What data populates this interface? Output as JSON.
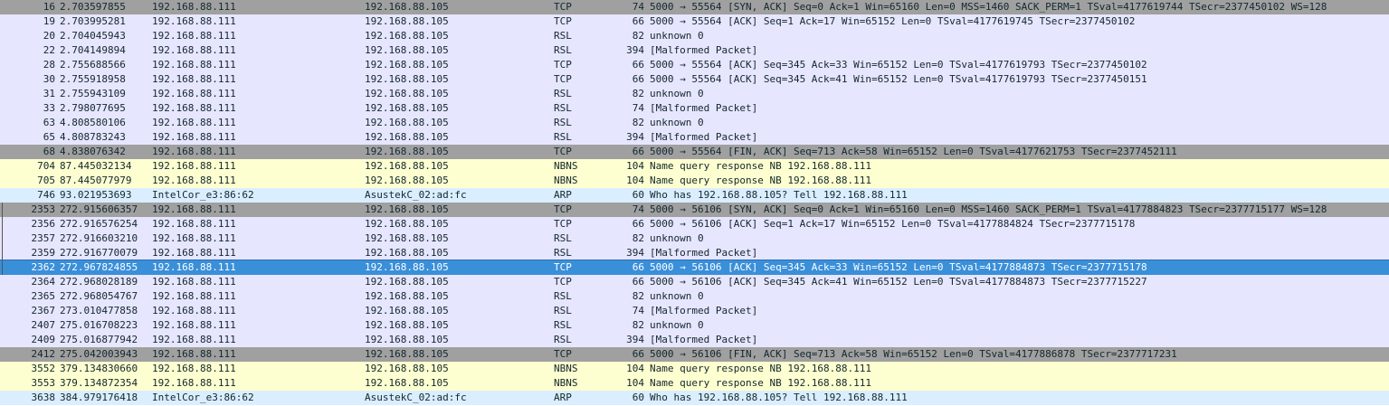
{
  "packets": [
    {
      "no": "16",
      "time": "2.703597855",
      "src": "192.168.88.111",
      "dst": "192.168.88.105",
      "proto": "TCP",
      "len": "74",
      "info": "5000 → 55564 [SYN, ACK] Seq=0 Ack=1 Win=65160 Len=0 MSS=1460 SACK_PERM=1 TSval=4177619744 TSecr=2377450102 WS=128",
      "style": "tcp-flag"
    },
    {
      "no": "19",
      "time": "2.703995281",
      "src": "192.168.88.111",
      "dst": "192.168.88.105",
      "proto": "TCP",
      "len": "66",
      "info": "5000 → 55564 [ACK] Seq=1 Ack=17 Win=65152 Len=0 TSval=4177619745 TSecr=2377450102",
      "style": "tcp"
    },
    {
      "no": "20",
      "time": "2.704045943",
      "src": "192.168.88.111",
      "dst": "192.168.88.105",
      "proto": "RSL",
      "len": "82",
      "info": "unknown 0",
      "style": "rsl"
    },
    {
      "no": "22",
      "time": "2.704149894",
      "src": "192.168.88.111",
      "dst": "192.168.88.105",
      "proto": "RSL",
      "len": "394",
      "info": "[Malformed Packet]",
      "style": "rsl"
    },
    {
      "no": "28",
      "time": "2.755688566",
      "src": "192.168.88.111",
      "dst": "192.168.88.105",
      "proto": "TCP",
      "len": "66",
      "info": "5000 → 55564 [ACK] Seq=345 Ack=33 Win=65152 Len=0 TSval=4177619793 TSecr=2377450102",
      "style": "tcp"
    },
    {
      "no": "30",
      "time": "2.755918958",
      "src": "192.168.88.111",
      "dst": "192.168.88.105",
      "proto": "TCP",
      "len": "66",
      "info": "5000 → 55564 [ACK] Seq=345 Ack=41 Win=65152 Len=0 TSval=4177619793 TSecr=2377450151",
      "style": "tcp"
    },
    {
      "no": "31",
      "time": "2.755943109",
      "src": "192.168.88.111",
      "dst": "192.168.88.105",
      "proto": "RSL",
      "len": "82",
      "info": "unknown 0",
      "style": "rsl"
    },
    {
      "no": "33",
      "time": "2.798077695",
      "src": "192.168.88.111",
      "dst": "192.168.88.105",
      "proto": "RSL",
      "len": "74",
      "info": "[Malformed Packet]",
      "style": "rsl"
    },
    {
      "no": "63",
      "time": "4.808580106",
      "src": "192.168.88.111",
      "dst": "192.168.88.105",
      "proto": "RSL",
      "len": "82",
      "info": "unknown 0",
      "style": "rsl"
    },
    {
      "no": "65",
      "time": "4.808783243",
      "src": "192.168.88.111",
      "dst": "192.168.88.105",
      "proto": "RSL",
      "len": "394",
      "info": "[Malformed Packet]",
      "style": "rsl"
    },
    {
      "no": "68",
      "time": "4.838076342",
      "src": "192.168.88.111",
      "dst": "192.168.88.105",
      "proto": "TCP",
      "len": "66",
      "info": "5000 → 55564 [FIN, ACK] Seq=713 Ack=58 Win=65152 Len=0 TSval=4177621753 TSecr=2377452111",
      "style": "tcp-flag"
    },
    {
      "no": "704",
      "time": "87.445032134",
      "src": "192.168.88.111",
      "dst": "192.168.88.105",
      "proto": "NBNS",
      "len": "104",
      "info": "Name query response NB 192.168.88.111",
      "style": "nbns"
    },
    {
      "no": "705",
      "time": "87.445077979",
      "src": "192.168.88.111",
      "dst": "192.168.88.105",
      "proto": "NBNS",
      "len": "104",
      "info": "Name query response NB 192.168.88.111",
      "style": "nbns"
    },
    {
      "no": "746",
      "time": "93.021953693",
      "src": "IntelCor_e3:86:62",
      "dst": "AsustekC_02:ad:fc",
      "proto": "ARP",
      "len": "60",
      "info": "Who has 192.168.88.105? Tell 192.168.88.111",
      "style": "arp"
    },
    {
      "no": "2353",
      "time": "272.915606357",
      "src": "192.168.88.111",
      "dst": "192.168.88.105",
      "proto": "TCP",
      "len": "74",
      "info": "5000 → 56106 [SYN, ACK] Seq=0 Ack=1 Win=65160 Len=0 MSS=1460 SACK_PERM=1 TSval=4177884823 TSecr=2377715177 WS=128",
      "style": "tcp-flag"
    },
    {
      "no": "2356",
      "time": "272.916576254",
      "src": "192.168.88.111",
      "dst": "192.168.88.105",
      "proto": "TCP",
      "len": "66",
      "info": "5000 → 56106 [ACK] Seq=1 Ack=17 Win=65152 Len=0 TSval=4177884824 TSecr=2377715178",
      "style": "tcp"
    },
    {
      "no": "2357",
      "time": "272.916603210",
      "src": "192.168.88.111",
      "dst": "192.168.88.105",
      "proto": "RSL",
      "len": "82",
      "info": "unknown 0",
      "style": "rsl"
    },
    {
      "no": "2359",
      "time": "272.916770079",
      "src": "192.168.88.111",
      "dst": "192.168.88.105",
      "proto": "RSL",
      "len": "394",
      "info": "[Malformed Packet]",
      "style": "rsl"
    },
    {
      "no": "2362",
      "time": "272.967824855",
      "src": "192.168.88.111",
      "dst": "192.168.88.105",
      "proto": "TCP",
      "len": "66",
      "info": "5000 → 56106 [ACK] Seq=345 Ack=33 Win=65152 Len=0 TSval=4177884873 TSecr=2377715178",
      "style": "selected"
    },
    {
      "no": "2364",
      "time": "272.968028189",
      "src": "192.168.88.111",
      "dst": "192.168.88.105",
      "proto": "TCP",
      "len": "66",
      "info": "5000 → 56106 [ACK] Seq=345 Ack=41 Win=65152 Len=0 TSval=4177884873 TSecr=2377715227",
      "style": "tcp"
    },
    {
      "no": "2365",
      "time": "272.968054767",
      "src": "192.168.88.111",
      "dst": "192.168.88.105",
      "proto": "RSL",
      "len": "82",
      "info": "unknown 0",
      "style": "rsl"
    },
    {
      "no": "2367",
      "time": "273.010477858",
      "src": "192.168.88.111",
      "dst": "192.168.88.105",
      "proto": "RSL",
      "len": "74",
      "info": "[Malformed Packet]",
      "style": "rsl"
    },
    {
      "no": "2407",
      "time": "275.016708223",
      "src": "192.168.88.111",
      "dst": "192.168.88.105",
      "proto": "RSL",
      "len": "82",
      "info": "unknown 0",
      "style": "rsl"
    },
    {
      "no": "2409",
      "time": "275.016877942",
      "src": "192.168.88.111",
      "dst": "192.168.88.105",
      "proto": "RSL",
      "len": "394",
      "info": "[Malformed Packet]",
      "style": "rsl"
    },
    {
      "no": "2412",
      "time": "275.042003943",
      "src": "192.168.88.111",
      "dst": "192.168.88.105",
      "proto": "TCP",
      "len": "66",
      "info": "5000 → 56106 [FIN, ACK] Seq=713 Ack=58 Win=65152 Len=0 TSval=4177886878 TSecr=2377717231",
      "style": "tcp-flag"
    },
    {
      "no": "3552",
      "time": "379.134830660",
      "src": "192.168.88.111",
      "dst": "192.168.88.105",
      "proto": "NBNS",
      "len": "104",
      "info": "Name query response NB 192.168.88.111",
      "style": "nbns"
    },
    {
      "no": "3553",
      "time": "379.134872354",
      "src": "192.168.88.111",
      "dst": "192.168.88.105",
      "proto": "NBNS",
      "len": "104",
      "info": "Name query response NB 192.168.88.111",
      "style": "nbns"
    },
    {
      "no": "3638",
      "time": "384.979176418",
      "src": "IntelCor_e3:86:62",
      "dst": "AsustekC_02:ad:fc",
      "proto": "ARP",
      "len": "60",
      "info": "Who has 192.168.88.105? Tell 192.168.88.111",
      "style": "arp"
    }
  ],
  "colors": {
    "tcp": "#e7e6ff",
    "tcp_flag": "#a0a0a0",
    "nbns": "#feffd0",
    "arp": "#daeeff",
    "selected": "#3a8fd9",
    "text": "#12272e"
  }
}
